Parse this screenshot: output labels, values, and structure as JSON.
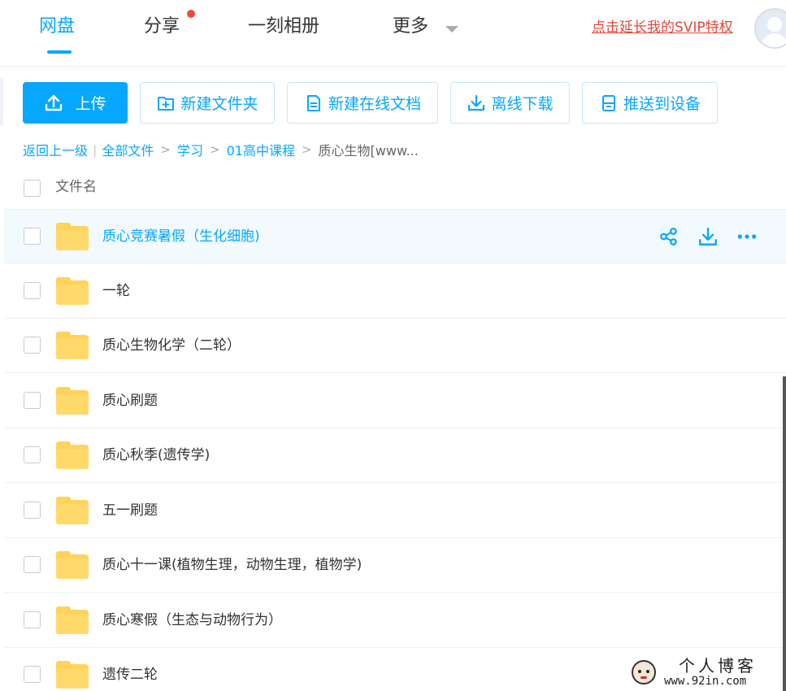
{
  "nav": {
    "items": [
      {
        "label": "网盘",
        "active": true
      },
      {
        "label": "分享",
        "active": false,
        "has_dot": true
      },
      {
        "label": "一刻相册",
        "active": false
      },
      {
        "label": "更多",
        "active": false,
        "has_caret": true
      }
    ],
    "svip_link": "点击延长我的SVIP特权",
    "accent": "#06a7ff",
    "link_color": "#e0473b"
  },
  "toolbar": {
    "upload": "上传",
    "new_folder": "新建文件夹",
    "new_online_doc": "新建在线文档",
    "offline_download": "离线下载",
    "push_to_device": "推送到设备"
  },
  "breadcrumb": {
    "back": "返回上一级",
    "items": [
      "全部文件",
      "学习",
      "01高中课程"
    ],
    "current": "质心生物[www..."
  },
  "list": {
    "header": "文件名",
    "rows": [
      {
        "name": "质心竞赛暑假（生化细胞)",
        "hover": true
      },
      {
        "name": "一轮"
      },
      {
        "name": "质心生物化学（二轮）"
      },
      {
        "name": "质心刷题"
      },
      {
        "name": "质心秋季(遗传学)"
      },
      {
        "name": "五一刷题"
      },
      {
        "name": "质心十一课(植物生理，动物生理，植物学)"
      },
      {
        "name": "质心寒假（生态与动物行为）"
      },
      {
        "name": "遗传二轮"
      }
    ],
    "row_actions": [
      "share-icon",
      "download-icon",
      "more-icon"
    ],
    "folder_color": "#ffd25a"
  },
  "watermark": {
    "title": "个人博客",
    "url": "www.92in.com"
  }
}
